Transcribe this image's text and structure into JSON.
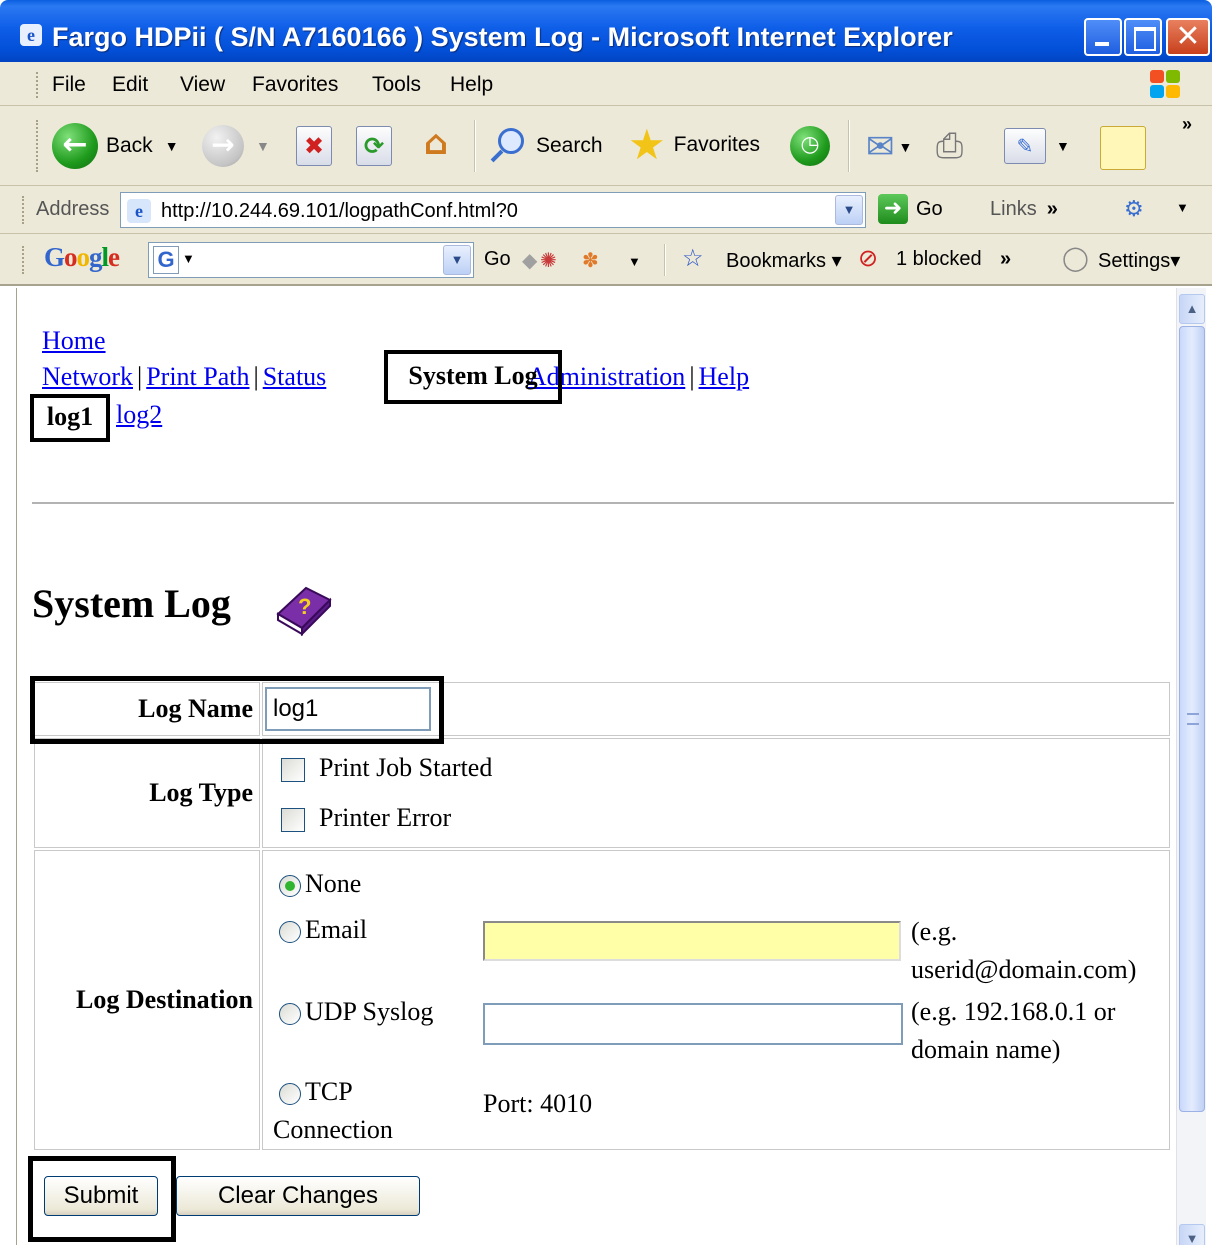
{
  "window": {
    "title": "Fargo HDPii ( S/N A7160166 ) System Log - Microsoft Internet Explorer"
  },
  "menu": [
    "File",
    "Edit",
    "View",
    "Favorites",
    "Tools",
    "Help"
  ],
  "toolbar": {
    "back_label": "Back",
    "search_label": "Search",
    "favorites_label": "Favorites"
  },
  "address": {
    "label": "Address",
    "url": "http://10.244.69.101/logpathConf.html?0",
    "go_label": "Go",
    "links_label": "Links"
  },
  "google_bar": {
    "logo": "Google",
    "search_value": "",
    "go_label": "Go",
    "bookmarks_label": "Bookmarks",
    "blocked_label": "1 blocked",
    "settings_label": "Settings"
  },
  "page": {
    "nav_home": "Home",
    "nav_network": "Network",
    "nav_print_path": "Print Path",
    "nav_status": "Status",
    "nav_system_log": "System Log",
    "nav_administration": "Administration",
    "nav_help": "Help",
    "sub_log1": "log1",
    "sub_log2": "log2",
    "heading": "System Log",
    "log_name_label": "Log Name",
    "log_name_value": "log1",
    "log_type_label": "Log Type",
    "log_type_opt1": "Print Job Started",
    "log_type_opt2": "Printer Error",
    "log_dest_label": "Log Destination",
    "dest_none": "None",
    "dest_email": "Email",
    "dest_email_hint_1": "(e.g.",
    "dest_email_hint_2": "userid@domain.com)",
    "dest_udp": "UDP Syslog",
    "dest_udp_hint_1": "(e.g. 192.168.0.1 or",
    "dest_udp_hint_2": "domain name)",
    "dest_tcp_1": "TCP",
    "dest_tcp_2": "Connection",
    "dest_port": "Port: 4010",
    "selected_destination": "None",
    "submit_label": "Submit",
    "clear_label": "Clear Changes"
  },
  "colors": {
    "email_field_bg": "#ffffa8",
    "link": "#0000ee",
    "titlebar": "#0350d8"
  }
}
